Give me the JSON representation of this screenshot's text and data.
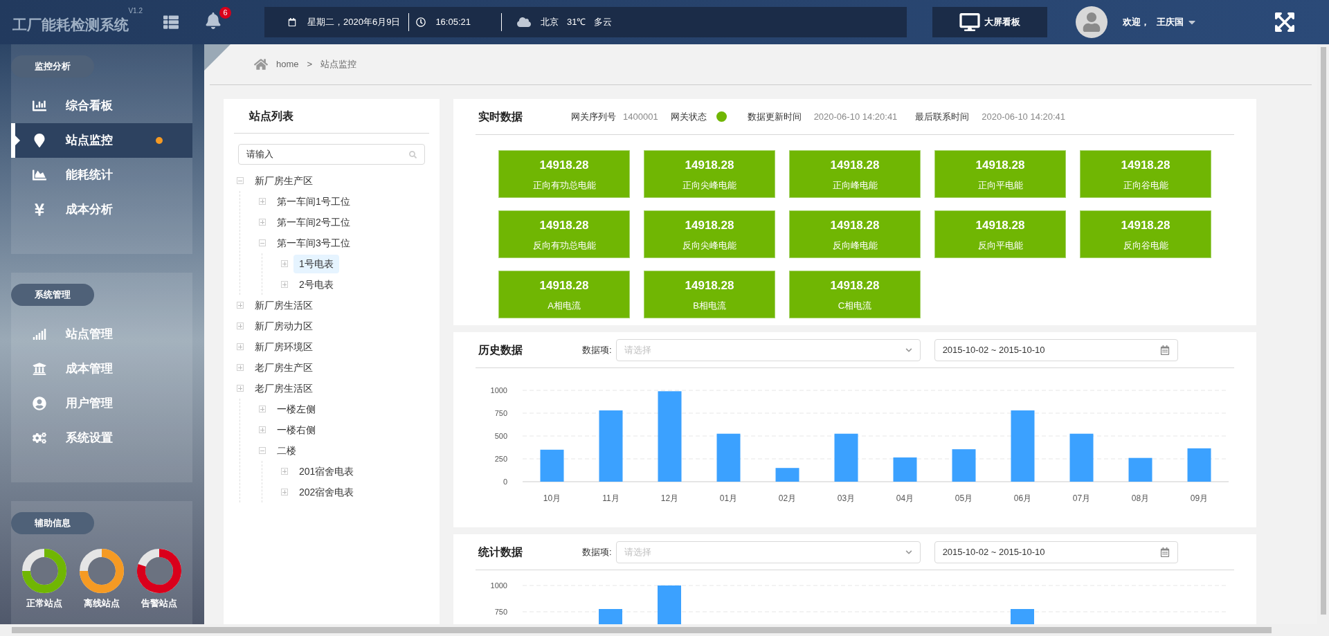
{
  "header": {
    "logo": "工厂能耗检测系统",
    "version": "V1.2",
    "notification_count": "6",
    "date": "星期二，2020年6月9日",
    "time": "16:05:21",
    "city": "北京",
    "temperature": "31℃",
    "weather": "多云",
    "screen_button": "大屏看板",
    "welcome": "欢迎，",
    "user": "王庆国"
  },
  "sidebar": {
    "sections": [
      {
        "title": "监控分析",
        "items": [
          {
            "label": "综合看板",
            "selected": false,
            "dot": false
          },
          {
            "label": "站点监控",
            "selected": true,
            "dot": true
          },
          {
            "label": "能耗统计",
            "selected": false,
            "dot": false
          },
          {
            "label": "成本分析",
            "selected": false,
            "dot": false
          }
        ]
      },
      {
        "title": "系统管理",
        "items": [
          {
            "label": "站点管理",
            "selected": false,
            "dot": false
          },
          {
            "label": "成本管理",
            "selected": false,
            "dot": false
          },
          {
            "label": "用户管理",
            "selected": false,
            "dot": false
          },
          {
            "label": "系统设置",
            "selected": false,
            "dot": false
          }
        ]
      }
    ],
    "aux": {
      "title": "辅助信息",
      "gauges": [
        {
          "label": "正常站点",
          "color": "#70b603"
        },
        {
          "label": "离线站点",
          "color": "#f59a23"
        },
        {
          "label": "告警站点",
          "color": "#d9001b"
        }
      ]
    }
  },
  "breadcrumb": {
    "home": "home",
    "separator": ">",
    "current": "站点监控"
  },
  "tree": {
    "title": "站点列表",
    "search_placeholder": "请输入",
    "nodes": [
      {
        "label": "新厂房生产区",
        "expanded": true,
        "selected": false,
        "children": [
          {
            "label": "第一车间1号工位",
            "expanded": false,
            "selected": false
          },
          {
            "label": "第一车间2号工位",
            "expanded": false,
            "selected": false
          },
          {
            "label": "第一车间3号工位",
            "expanded": true,
            "selected": false,
            "children": [
              {
                "label": "1号电表",
                "expanded": false,
                "selected": true
              },
              {
                "label": "2号电表",
                "expanded": false,
                "selected": false
              }
            ]
          }
        ]
      },
      {
        "label": "新厂房生活区",
        "expanded": false,
        "selected": false
      },
      {
        "label": "新厂房动力区",
        "expanded": false,
        "selected": false
      },
      {
        "label": "新厂房环境区",
        "expanded": false,
        "selected": false
      },
      {
        "label": "老厂房生产区",
        "expanded": false,
        "selected": false
      },
      {
        "label": "老厂房生活区",
        "expanded": false,
        "selected": false,
        "children": [
          {
            "label": "一楼左侧",
            "expanded": false,
            "selected": false
          },
          {
            "label": "一楼右侧",
            "expanded": false,
            "selected": false
          },
          {
            "label": "二楼",
            "expanded": true,
            "selected": false,
            "children": [
              {
                "label": "201宿舍电表",
                "expanded": false,
                "selected": false
              },
              {
                "label": "202宿舍电表",
                "expanded": false,
                "selected": false
              }
            ]
          }
        ]
      }
    ]
  },
  "realtime": {
    "title": "实时数据",
    "serial_label": "网关序列号",
    "serial": "1400001",
    "status_label": "网关状态",
    "online": true,
    "update_label": "数据更新时间",
    "update_time": "2020-06-10 14:20:41",
    "contact_label": "最后联系时间",
    "contact_time": "2020-06-10 14:20:41",
    "cards": [
      {
        "value": "14918.28",
        "label": "正向有功总电能"
      },
      {
        "value": "14918.28",
        "label": "正向尖峰电能"
      },
      {
        "value": "14918.28",
        "label": "正向峰电能"
      },
      {
        "value": "14918.28",
        "label": "正向平电能"
      },
      {
        "value": "14918.28",
        "label": "正向谷电能"
      },
      {
        "value": "14918.28",
        "label": "反向有功总电能"
      },
      {
        "value": "14918.28",
        "label": "反向尖峰电能"
      },
      {
        "value": "14918.28",
        "label": "反向峰电能"
      },
      {
        "value": "14918.28",
        "label": "反向平电能"
      },
      {
        "value": "14918.28",
        "label": "反向谷电能"
      },
      {
        "value": "14918.28",
        "label": "A相电流"
      },
      {
        "value": "14918.28",
        "label": "B相电流"
      },
      {
        "value": "14918.28",
        "label": "C相电流"
      }
    ]
  },
  "history": {
    "title": "历史数据",
    "field_label": "数据项:",
    "field_placeholder": "请选择",
    "date_range": "2015-10-02 ~ 2015-10-10",
    "chart_data": {
      "type": "bar",
      "categories": [
        "10月",
        "11月",
        "12月",
        "01月",
        "02月",
        "03月",
        "04月",
        "05月",
        "06月",
        "07月",
        "08月",
        "09月"
      ],
      "values": [
        350,
        780,
        990,
        525,
        150,
        525,
        265,
        355,
        780,
        525,
        260,
        365
      ],
      "ylim": [
        0,
        1000
      ],
      "yticks": [
        0,
        250,
        500,
        750,
        1000
      ],
      "grid": true
    }
  },
  "statistics": {
    "title": "统计数据",
    "field_label": "数据项:",
    "field_placeholder": "请选择",
    "date_range": "2015-10-02 ~ 2015-10-10",
    "y_tick_labels": [
      "1000",
      "750"
    ]
  }
}
